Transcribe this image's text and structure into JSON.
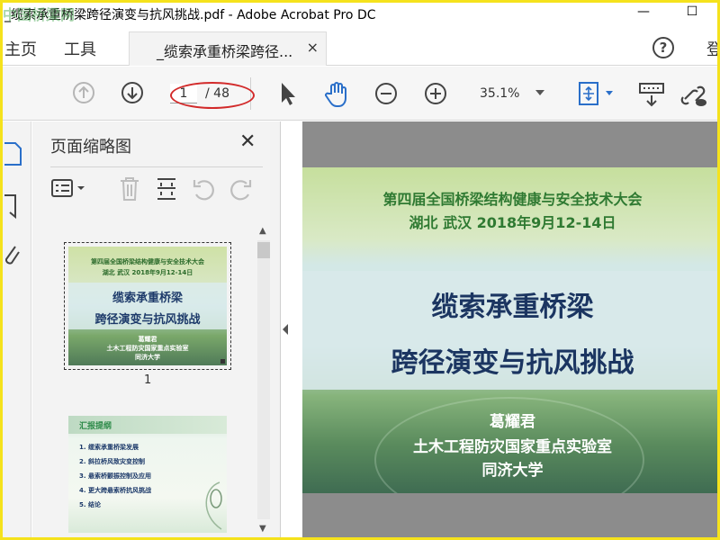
{
  "window": {
    "title": "_缆索承重桥梁跨径演变与抗风挑战.pdf - Adobe Acrobat Pro DC",
    "watermark": "中国桥梁网",
    "minimize": "—",
    "maximize": "☐"
  },
  "tabs": {
    "home": "主页",
    "tools": "工具",
    "document": "_缆索承重桥梁跨径...",
    "close": "×",
    "help": "?",
    "login": "登"
  },
  "toolbar": {
    "current_page": "1",
    "total_pages": "/ 48",
    "zoom": "35.1%"
  },
  "thumbnails_panel": {
    "title": "页面缩略图",
    "close": "✕",
    "thumb1": {
      "line1": "第四届全国桥梁结构健康与安全技术大会",
      "line2": "湖北 武汉 2018年9月12-14日",
      "title1": "缆索承重桥梁",
      "title2": "跨径演变与抗风挑战",
      "author": "葛耀君",
      "org1": "土木工程防灾国家重点实验室",
      "org2": "同济大学",
      "page_number": "1"
    },
    "thumb2": {
      "heading": "汇报提纲",
      "items": [
        "1. 缆索承重桥梁发展",
        "2. 斜拉桥风致灾变控制",
        "3. 悬索桥颤振控制及应用",
        "4. 更大跨悬索桥抗风挑战",
        "5. 结论"
      ]
    }
  },
  "slide": {
    "conference": "第四届全国桥梁结构健康与安全技术大会",
    "location_date": "湖北  武汉  2018年9月12-14日",
    "title_line1": "缆索承重桥梁",
    "title_line2": "跨径演变与抗风挑战",
    "author": "葛耀君",
    "lab": "土木工程防灾国家重点实验室",
    "university": "同济大学"
  },
  "colors": {
    "highlight_oval": "#d22a2a",
    "window_border": "#f5e21c",
    "slide_title": "#1b3561",
    "slide_subtitle": "#2f7a32"
  }
}
